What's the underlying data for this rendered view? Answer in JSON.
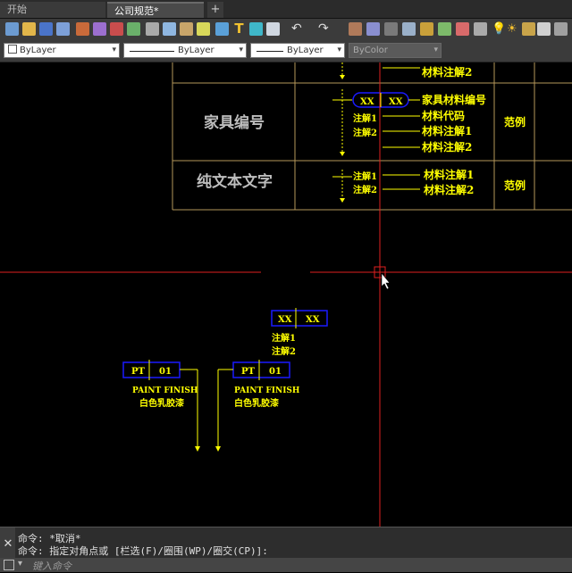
{
  "tabs": {
    "start": "开始",
    "file": "公司规范*",
    "add": "+"
  },
  "toolbar": {
    "icons": [
      "new-icon",
      "open-icon",
      "save-icon",
      "saveas-icon",
      "plot-icon",
      "plot-preview-icon",
      "publish-icon",
      "3d-dwf-icon",
      "cut-icon",
      "copy-icon",
      "paste-icon",
      "match-properties-icon",
      "block-editor-icon",
      "text-icon",
      "hatch-icon",
      "table-icon",
      "undo-icon",
      "redo-icon",
      "pan-icon",
      "zoom-icon",
      "zoom-window-icon",
      "properties-icon",
      "design-center-icon",
      "tool-palettes-icon",
      "sheet-set-icon",
      "markup-icon",
      "calc-icon",
      "layer-icon",
      "light-icon",
      "sun-icon",
      "lock-icon",
      "layer-state-icon"
    ]
  },
  "properties": {
    "color": "ByLayer",
    "linetype": "ByLayer",
    "lineweight": "ByLayer",
    "plotstyle": "ByColor"
  },
  "drawing": {
    "row_top_label": "材料注解2",
    "row1": {
      "title": "家具编号",
      "tag_left": "XX",
      "tag_right": "XX",
      "note1": "注解1",
      "note2": "注解2",
      "legend": [
        "家具材料编号",
        "材料代码",
        "材料注解1",
        "材料注解2"
      ],
      "example": "范例"
    },
    "row2": {
      "title": "纯文本文字",
      "note1": "注解1",
      "note2": "注解2",
      "legend": [
        "材料注解1",
        "材料注解2"
      ],
      "example": "范例"
    },
    "tag_xx": {
      "left": "XX",
      "right": "XX",
      "note1": "注解1",
      "note2": "注解2"
    },
    "tag_pt_a": {
      "left": "PT",
      "right": "01",
      "line1": "PAINT FINISH",
      "line2": "白色乳胶漆"
    },
    "tag_pt_b": {
      "left": "PT",
      "right": "01",
      "line1": "PAINT FINISH",
      "line2": "白色乳胶漆"
    }
  },
  "colors": {
    "accent": "#ffff00",
    "crosshair": "#e02020",
    "box": "#1a1aff",
    "grid": "#b5975a",
    "title_text": "#bdbdbd"
  },
  "command": {
    "line1": "命令: *取消*",
    "line2": "命令: 指定对角点或 [栏选(F)/圈围(WP)/圈交(CP)]:",
    "placeholder": "键入命令"
  }
}
